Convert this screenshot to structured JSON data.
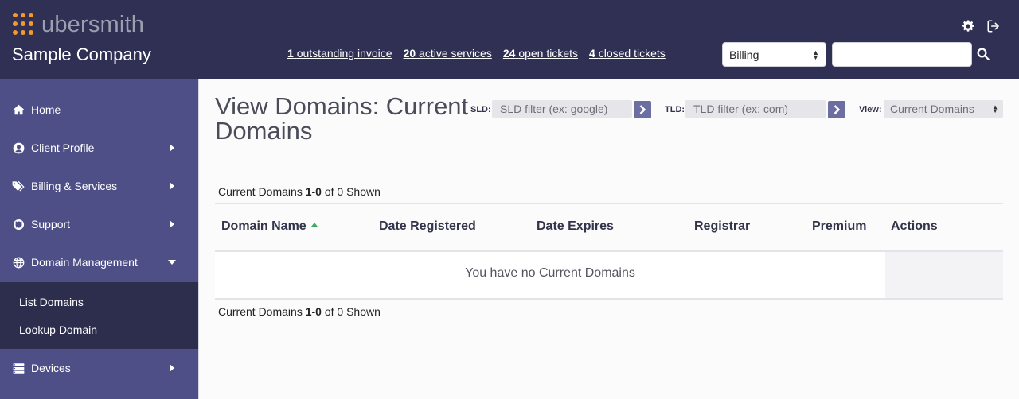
{
  "header": {
    "logo_text": "ubersmith",
    "company_name": "Sample Company",
    "links": [
      {
        "count": "1",
        "text": "outstanding invoice"
      },
      {
        "count": "20",
        "text": "active services"
      },
      {
        "count": "24",
        "text": "open tickets"
      },
      {
        "count": "4",
        "text": "closed tickets"
      }
    ],
    "search_scope": "Billing",
    "search_value": "",
    "settings_icon": "gear-icon",
    "logout_icon": "logout-icon",
    "search_icon": "search-icon"
  },
  "sidebar": {
    "items": [
      {
        "label": "Home",
        "icon": "home-icon"
      },
      {
        "label": "Client Profile",
        "icon": "user-circle-icon"
      },
      {
        "label": "Billing & Services",
        "icon": "tags-icon"
      },
      {
        "label": "Support",
        "icon": "lifering-icon"
      },
      {
        "label": "Domain Management",
        "icon": "globe-icon"
      },
      {
        "label": "Devices",
        "icon": "server-icon"
      }
    ],
    "submenu": [
      {
        "label": "List Domains"
      },
      {
        "label": "Lookup Domain"
      }
    ]
  },
  "main": {
    "title": "View Domains: Current Domains",
    "sld_label": "SLD:",
    "sld_placeholder": "SLD filter (ex: google)",
    "tld_label": "TLD:",
    "tld_placeholder": "TLD filter (ex: com)",
    "view_label": "View:",
    "view_value": "Current Domains",
    "shown": {
      "prefix": "Current Domains",
      "range": "1-0",
      "suffix": "of 0 Shown"
    },
    "columns": [
      "Domain Name",
      "Date Registered",
      "Date Expires",
      "Registrar",
      "Premium",
      "Actions"
    ],
    "empty_message": "You have no Current Domains"
  },
  "colors": {
    "header_bg": "#2f3053",
    "sidebar_bg": "#4e4f87",
    "submenu_bg": "#2d2e4e",
    "logo_dots": "#f39a2b",
    "filter_button": "#6c6da0",
    "sort_indicator": "#3cad5b"
  }
}
